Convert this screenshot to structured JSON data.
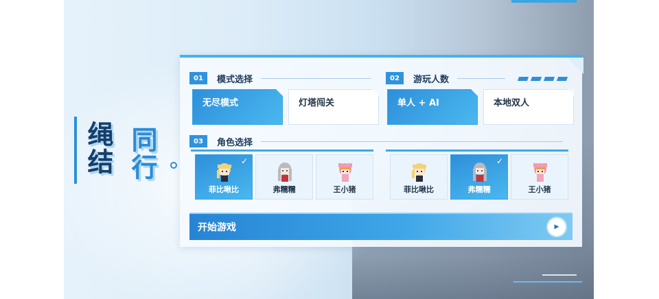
{
  "title": {
    "line1": "绳结",
    "line2": "同行"
  },
  "mode_section": {
    "num": "01",
    "label": "模式选择",
    "options": [
      {
        "label": "无尽模式",
        "selected": true
      },
      {
        "label": "灯塔闯关",
        "selected": false
      }
    ]
  },
  "players_section": {
    "num": "02",
    "label": "游玩人数",
    "options": [
      {
        "label": "单人 + AI",
        "selected": true
      },
      {
        "label": "本地双人",
        "selected": false
      }
    ]
  },
  "character_section": {
    "num": "03",
    "label": "角色选择",
    "player1": [
      {
        "name": "菲比啾比",
        "selected": true
      },
      {
        "name": "弗糯糯",
        "selected": false
      },
      {
        "name": "王小猪",
        "selected": false
      }
    ],
    "player2": [
      {
        "name": "菲比啾比",
        "selected": false
      },
      {
        "name": "弗糯糯",
        "selected": true
      },
      {
        "name": "王小猪",
        "selected": false
      }
    ],
    "check_mark": "✓"
  },
  "start_button": {
    "label": "开始游戏",
    "icon": "play-icon",
    "glyph": "▶"
  },
  "colors": {
    "accent": "#2f93dd",
    "title_dark": "#173e6a",
    "title_light": "#2a8bd6"
  }
}
